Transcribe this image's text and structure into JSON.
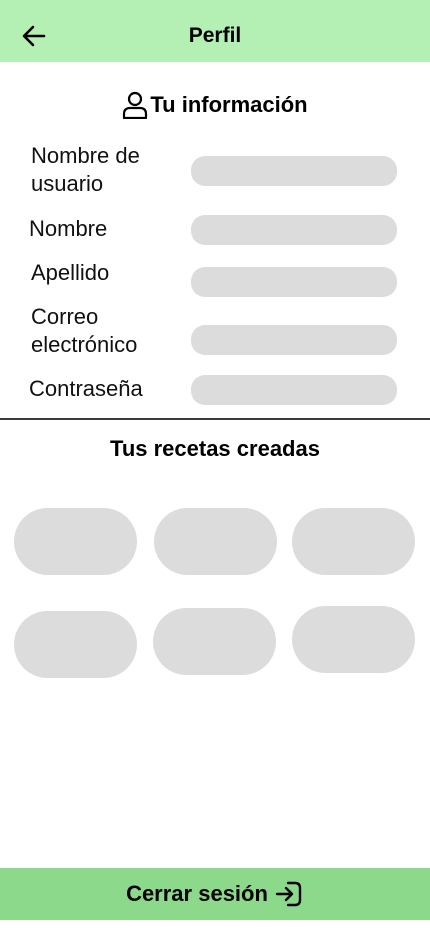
{
  "header": {
    "title": "Perfil",
    "back_icon": "arrow-left-icon"
  },
  "info": {
    "title": "Tu información",
    "icon": "user-icon",
    "fields": [
      {
        "label": "Nombre de usuario",
        "value": ""
      },
      {
        "label": "Nombre",
        "value": ""
      },
      {
        "label": "Apellido",
        "value": ""
      },
      {
        "label": "Correo electrónico",
        "value": ""
      },
      {
        "label": "Contraseña",
        "value": ""
      }
    ]
  },
  "recipes": {
    "title": "Tus recetas creadas",
    "count": 6
  },
  "footer": {
    "logout_label": "Cerrar sesión",
    "logout_icon": "logout-icon"
  },
  "colors": {
    "header_bg": "#b4f0b4",
    "footer_bg": "#8cd98c",
    "placeholder": "#dcdcdc"
  }
}
